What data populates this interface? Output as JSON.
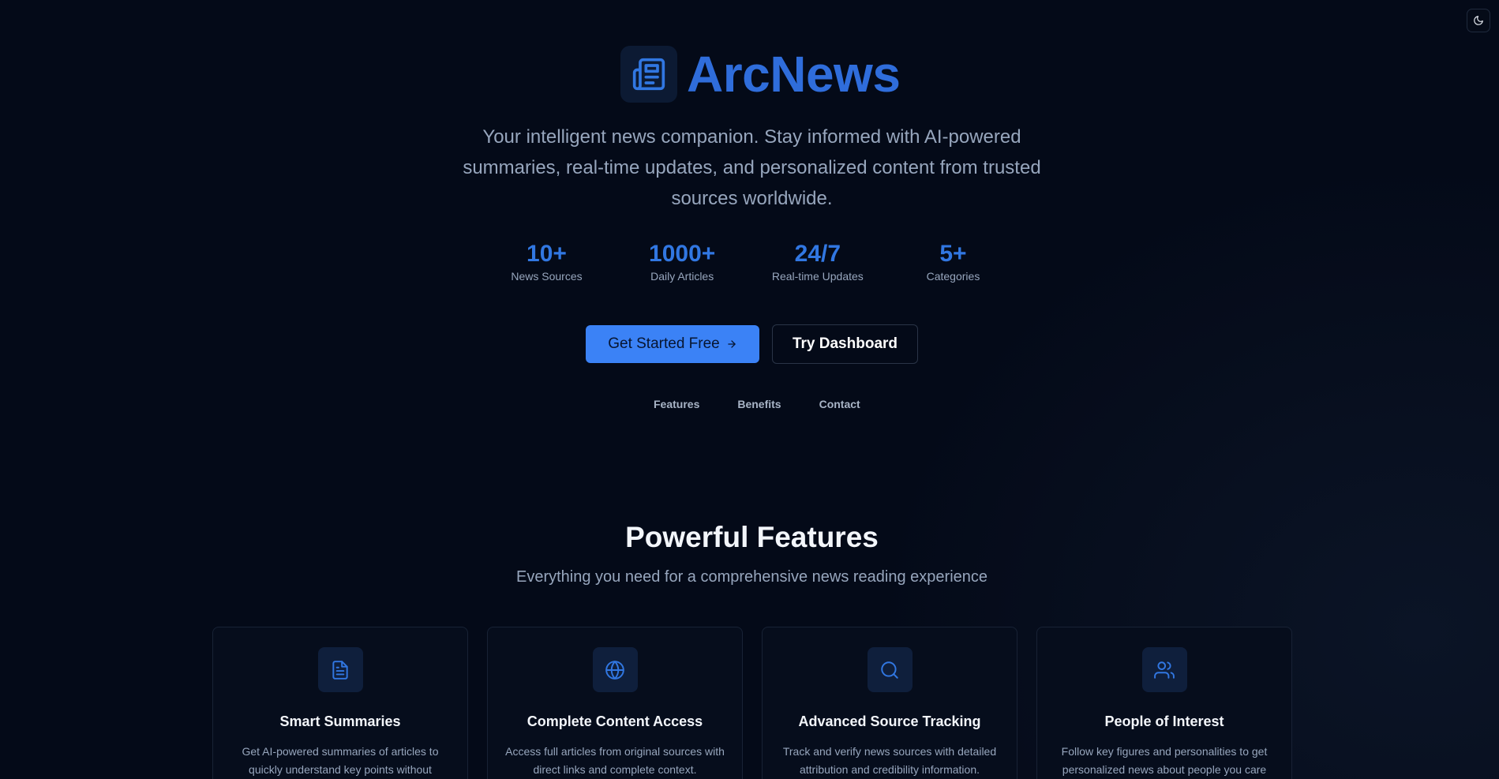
{
  "brand": {
    "name": "ArcNews",
    "icon": "newspaper-icon",
    "accent": "#2f6ddb"
  },
  "theme_toggle": {
    "icon": "moon-icon"
  },
  "hero": {
    "tagline": "Your intelligent news companion. Stay informed with AI-powered summaries, real-time updates, and personalized content from trusted sources worldwide."
  },
  "stats": [
    {
      "value": "10+",
      "label": "News Sources"
    },
    {
      "value": "1000+",
      "label": "Daily Articles"
    },
    {
      "value": "24/7",
      "label": "Real-time Updates"
    },
    {
      "value": "5+",
      "label": "Categories"
    }
  ],
  "cta": {
    "primary_label": "Get Started Free",
    "primary_icon": "arrow-right-icon",
    "secondary_label": "Try Dashboard",
    "primary_color": "#3b82f6"
  },
  "subnav": [
    {
      "label": "Features"
    },
    {
      "label": "Benefits"
    },
    {
      "label": "Contact"
    }
  ],
  "features": {
    "title": "Powerful Features",
    "subtitle": "Everything you need for a comprehensive news reading experience",
    "cards": [
      {
        "icon": "document-icon",
        "title": "Smart Summaries",
        "description": "Get AI-powered summaries of articles to quickly understand key points without"
      },
      {
        "icon": "globe-icon",
        "title": "Complete Content Access",
        "description": "Access full articles from original sources with direct links and complete context."
      },
      {
        "icon": "search-icon",
        "title": "Advanced Source Tracking",
        "description": "Track and verify news sources with detailed attribution and credibility information."
      },
      {
        "icon": "users-icon",
        "title": "People of Interest",
        "description": "Follow key figures and personalities to get personalized news about people you care"
      }
    ]
  }
}
